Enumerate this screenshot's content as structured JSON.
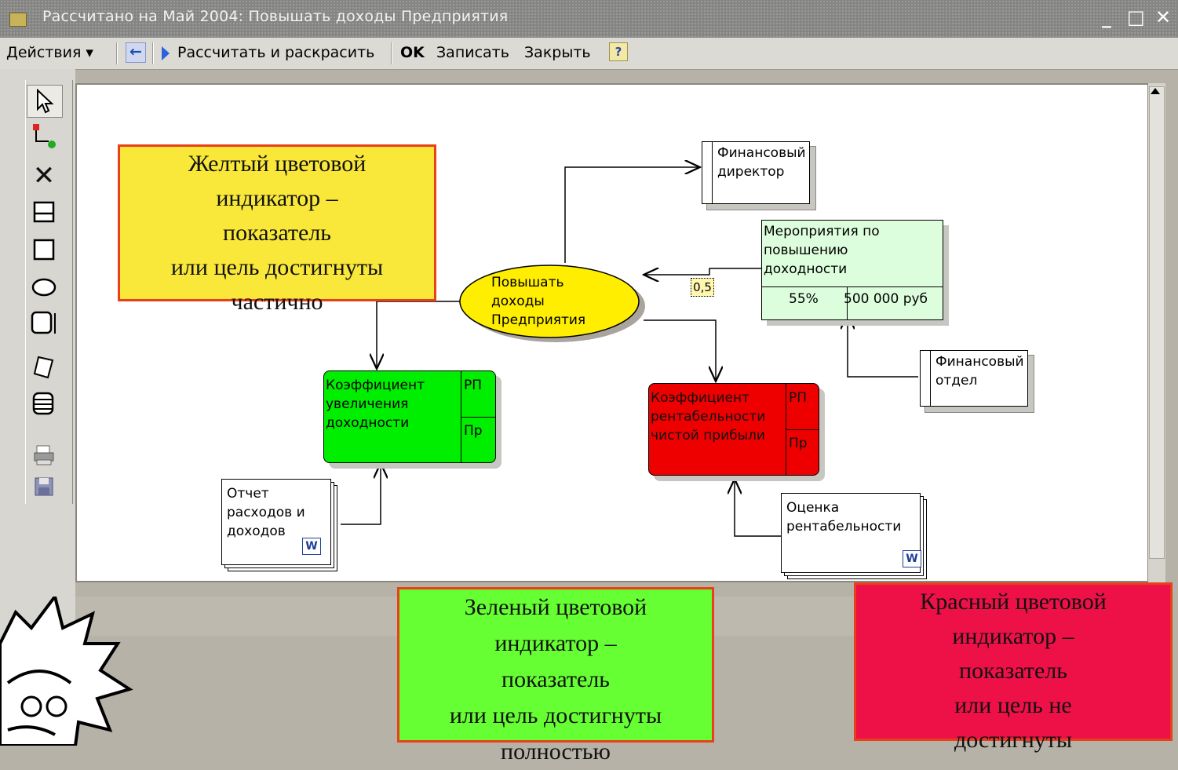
{
  "window": {
    "title": "Рассчитано на Май 2004: Повышать доходы Предприятия",
    "minimize": "_",
    "maximize": "□",
    "close": "✕"
  },
  "toolbar": {
    "actions": "Действия ▾",
    "back": "←",
    "calc": "Рассчитать и раскрасить",
    "ok": "OK",
    "save": "Записать",
    "close": "Закрыть",
    "help": "?"
  },
  "palette": [
    "pointer-icon",
    "connector-icon",
    "delete-icon",
    "frame-icon",
    "rectangle-icon",
    "ellipse-icon",
    "block-icon",
    "document-icon",
    "database-icon",
    "print-icon",
    "save-icon"
  ],
  "diagram": {
    "goal": "Повышать\nдоходы\nПредприятия",
    "fin_director": "Финансовый\nдиректор",
    "measures": {
      "label": "Мероприятия по\nповышению\nдоходности",
      "percent": "55%",
      "amount": "500 000 руб"
    },
    "weight": "0,5",
    "fin_dept": "Финансовый\nотдел",
    "green_kpi": {
      "label": "Коэффициент\nувеличения\nдоходности",
      "rp": "РП",
      "pr": "Пр"
    },
    "red_kpi": {
      "label": "Коэффициент\nрентабельности\nчистой прибыли",
      "rp": "РП",
      "pr": "Пр"
    },
    "report": "Отчет\nрасходов и\nдоходов",
    "assessment": "Оценка\nрентабельности",
    "word_icon": "W"
  },
  "legends": {
    "yellow": "Желтый цветовой\nиндикатор –\nпоказатель\nили цель достигнуты\nчастично",
    "green": "Зеленый цветовой\nиндикатор –\nпоказатель\nили цель достигнуты\nполностью",
    "red": "Красный цветовой\nиндикатор –\nпоказатель\nили цель не\nдостигнуты"
  },
  "colors": {
    "yellow_box": "#f9e83a",
    "green_box": "#66ff33",
    "red_box": "#ee1148",
    "green_node": "#00ee00",
    "red_node": "#ee0000",
    "goal_fill": "#ffee00",
    "measures_fill": "#ddfedd"
  }
}
